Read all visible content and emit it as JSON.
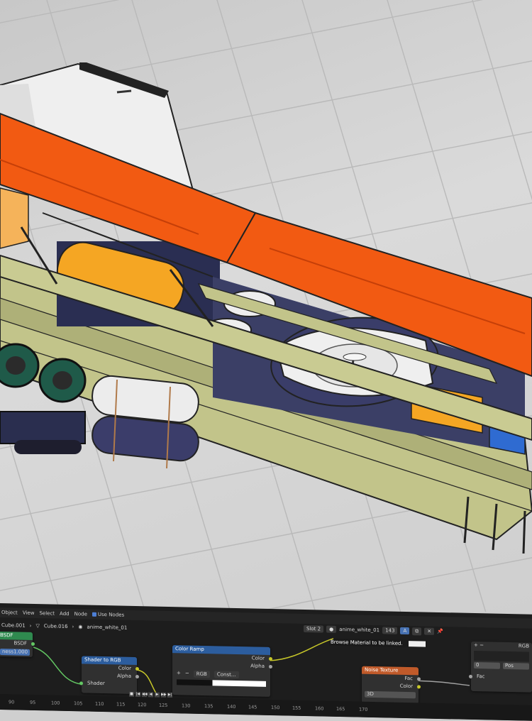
{
  "viewport": {
    "colors": {
      "hull_orange": "#f25a12",
      "frame_olive": "#c2c48a",
      "tank_yellow": "#f5a623",
      "wing_white": "#efefef",
      "grid_bg": "#d2d2d2"
    }
  },
  "node_editor": {
    "header": {
      "editor_type": "Object",
      "menus": [
        "View",
        "Select",
        "Add",
        "Node"
      ],
      "use_nodes": "Use Nodes",
      "slot": "Slot 2",
      "material_name": "anime_white_01",
      "user_count": "143",
      "tooltip": "Browse Material to be linked."
    },
    "breadcrumb": {
      "object": "Cube.001",
      "mesh": "Cube.016",
      "material": "anime_white_01"
    },
    "nodes": {
      "bsdf": {
        "title": "BSDF",
        "output": "BSDF",
        "field_label": "ness",
        "field_value": "1.000"
      },
      "shader_to_rgb": {
        "title": "Shader to RGB",
        "out_color": "Color",
        "out_alpha": "Alpha",
        "input": "Shader"
      },
      "color_ramp": {
        "title": "Color Ramp",
        "out_color": "Color",
        "out_alpha": "Alpha",
        "add": "+",
        "remove": "−",
        "mode": "RGB",
        "interp": "Const..."
      },
      "noise_texture": {
        "title": "Noise Texture",
        "out_fac": "Fac",
        "out_color": "Color",
        "dimension": "3D"
      },
      "rgb_curves": {
        "title": "RGB",
        "field_a": "0",
        "field_b": "Pos",
        "input": "Fac"
      }
    },
    "timeline": {
      "ticks": [
        "90",
        "95",
        "100",
        "105",
        "110",
        "115",
        "120",
        "125",
        "130",
        "135",
        "140",
        "145",
        "150",
        "155",
        "160",
        "165",
        "170"
      ]
    }
  }
}
